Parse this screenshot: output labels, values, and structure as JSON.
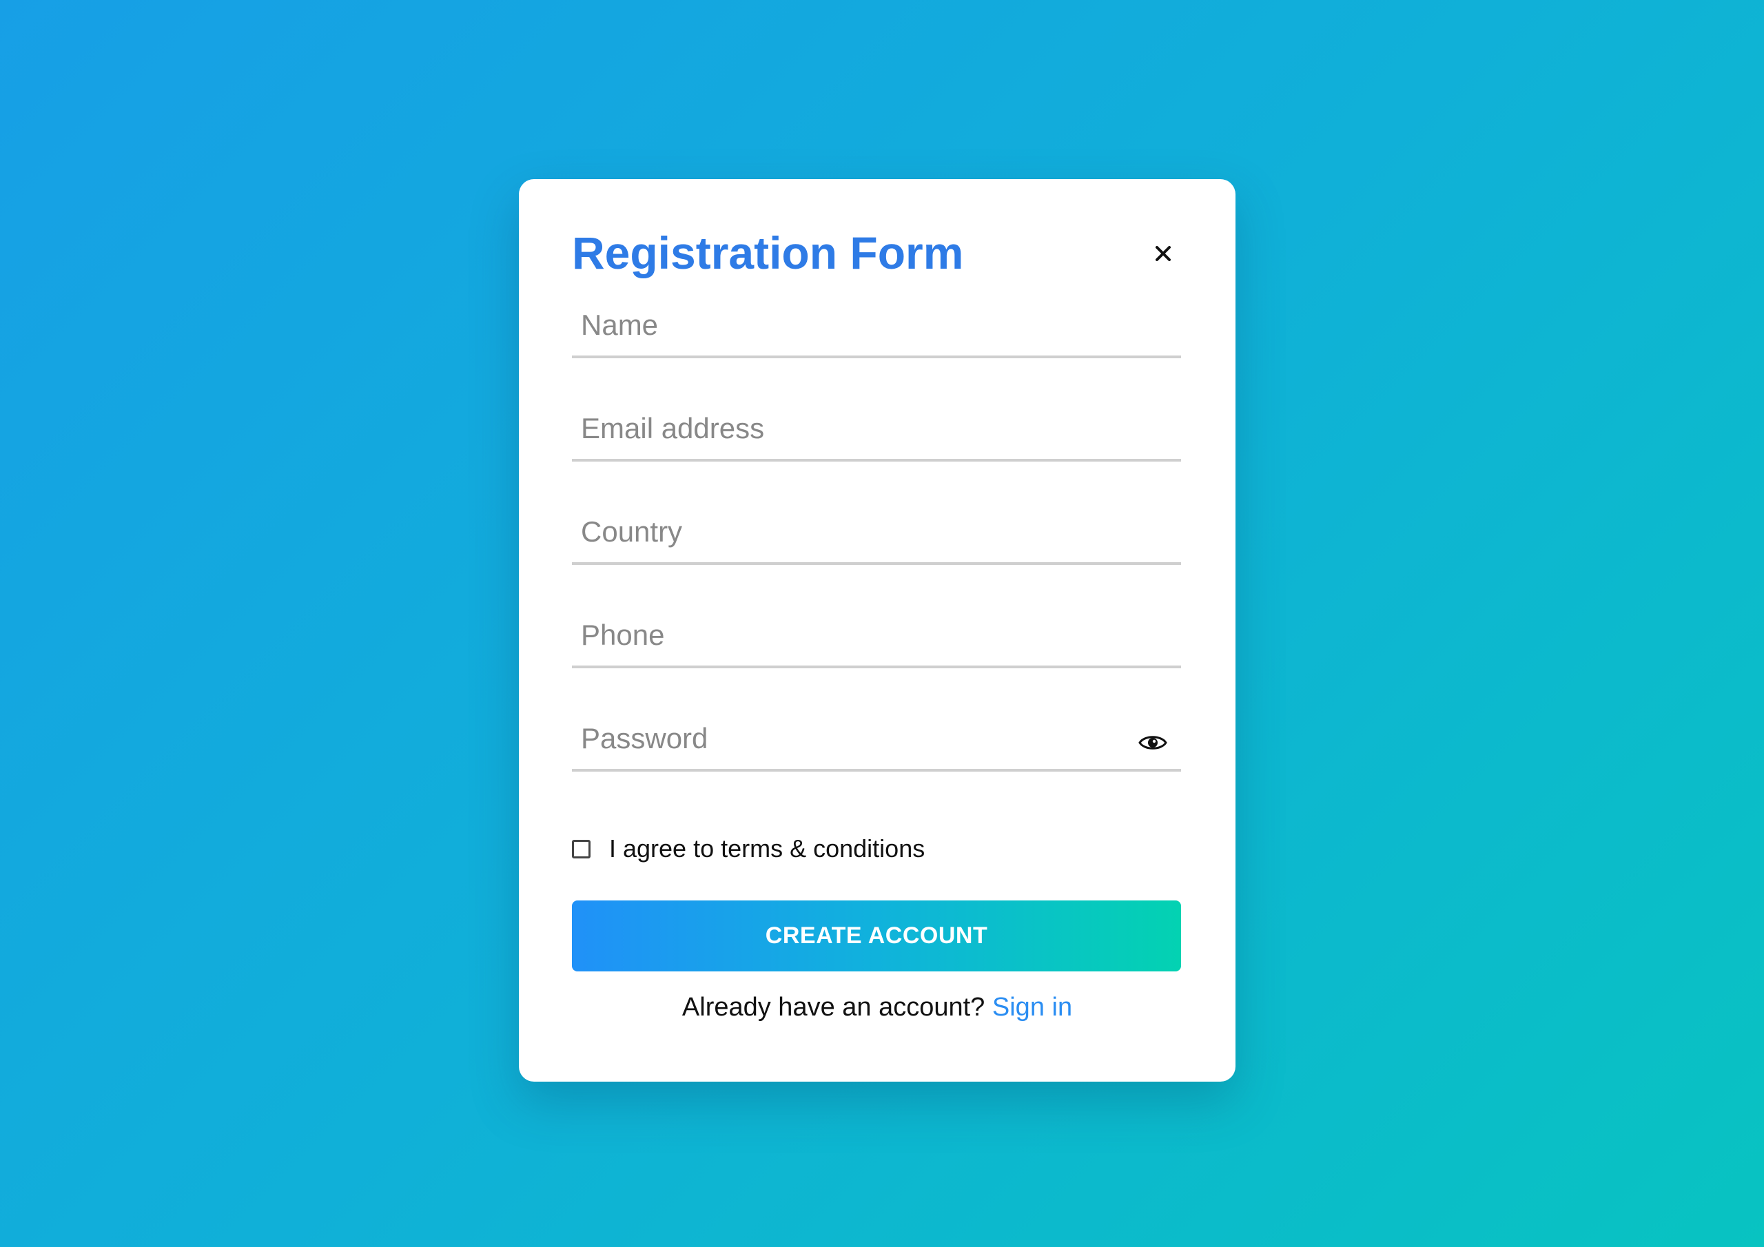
{
  "form": {
    "title": "Registration Form",
    "close_symbol": "×",
    "fields": {
      "name": {
        "placeholder": "Name",
        "value": ""
      },
      "email": {
        "placeholder": "Email address",
        "value": ""
      },
      "country": {
        "placeholder": "Country",
        "value": ""
      },
      "phone": {
        "placeholder": "Phone",
        "value": ""
      },
      "password": {
        "placeholder": "Password",
        "value": ""
      }
    },
    "password_toggle_icon": "eye-icon",
    "terms": {
      "checked": false,
      "label": "I agree to terms & conditions"
    },
    "submit_label": "CREATE ACCOUNT",
    "footer": {
      "prompt": "Already have an account?",
      "link_label": "Sign in"
    }
  },
  "colors": {
    "background_start": "#179fe6",
    "background_end": "#08c3c1",
    "title": "#2e7be6",
    "button_start": "#2091f8",
    "button_end": "#03d2b2",
    "link": "#2a8df2"
  }
}
